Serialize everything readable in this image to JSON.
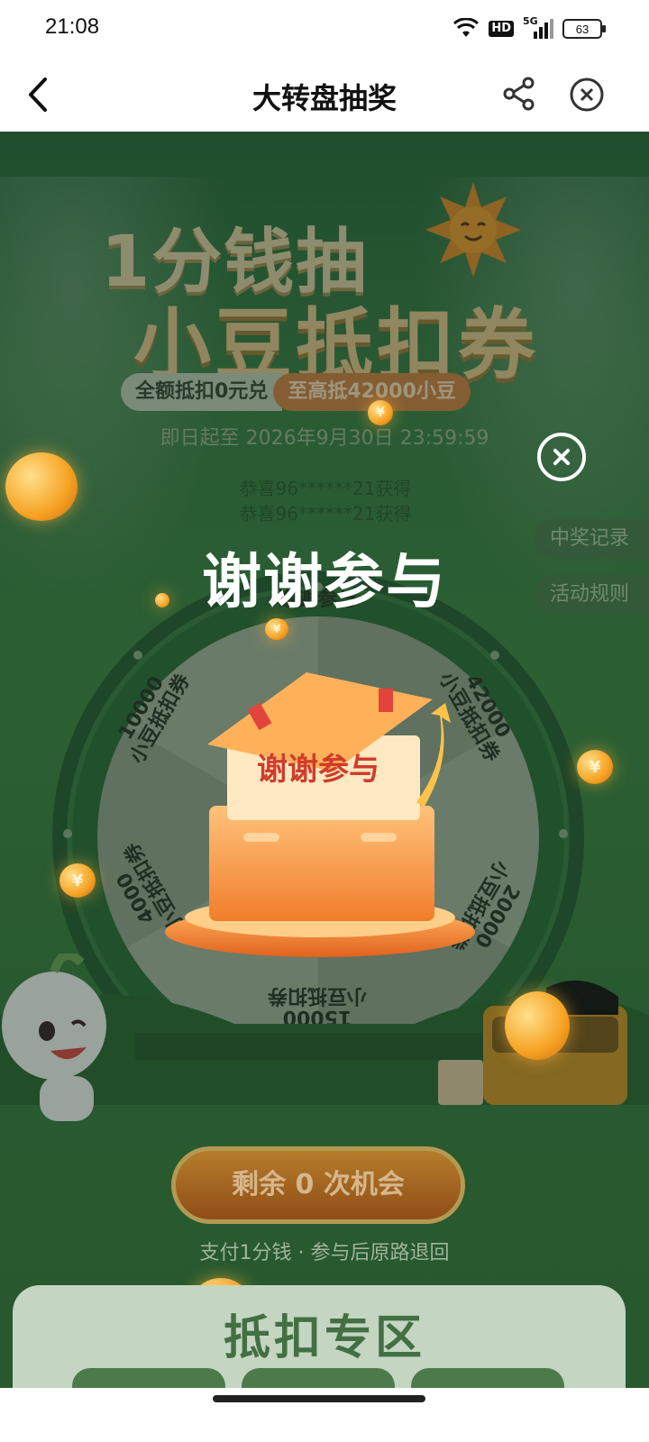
{
  "status_bar": {
    "time": "21:08",
    "hd_label": "HD",
    "network_label": "5G",
    "battery_level": "63"
  },
  "nav": {
    "title": "大转盘抽奖"
  },
  "promo": {
    "headline_line1": "1分钱抽",
    "headline_line2": "小豆抵扣券",
    "pill_left": "全额抵扣0元兑",
    "pill_right": "至高抵42000小豆",
    "date_range": "即日起至 2026年9月30日 23:59:59"
  },
  "ticker": {
    "lines": [
      "恭喜96******21获得",
      "恭喜96******21获得"
    ]
  },
  "side_tabs": {
    "records": "中奖记录",
    "rules": "活动规则"
  },
  "wheel": {
    "segments": [
      "谢谢参与",
      "42000\n小豆抵扣券",
      "20000\n小豆抵扣券",
      "15000\n小豆抵扣券",
      "4000\n小豆抵扣券",
      "10000\n小豆抵扣券"
    ]
  },
  "result": {
    "title": "谢谢参与",
    "box_label": "谢谢参与"
  },
  "cta": {
    "label": "剩余 0 次机会",
    "subtext": "支付1分钱 · 参与后原路退回"
  },
  "section": {
    "title": "抵扣专区"
  },
  "colors": {
    "background_green": "#3b7d48",
    "accent_orange": "#f6a223",
    "result_text": "#ffffff",
    "box_label_red": "#d03c2b"
  }
}
